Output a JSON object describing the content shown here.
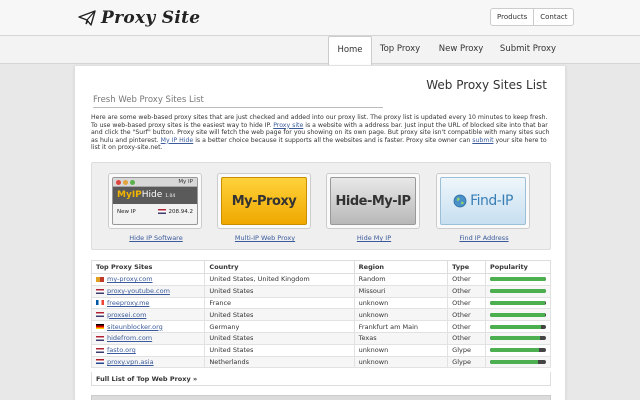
{
  "site": {
    "logo_text": "Proxy Site",
    "logo_icon": "paper-plane-icon"
  },
  "top_links": [
    "Products",
    "Contact"
  ],
  "nav": [
    "Home",
    "Top Proxy",
    "New Proxy",
    "Submit Proxy"
  ],
  "nav_active": "Home",
  "page_title": "Web Proxy Sites List",
  "section_title": "Fresh Web Proxy Sites List",
  "intro": {
    "p1": "Here are some web-based proxy sites that are just checked and added into our proxy list. The proxy list is updated every 10 minutes to keep fresh. To use web-based proxy sites is the easiest way to hide IP. ",
    "link1": "Proxy site",
    "p2": " is a website with a address bar. Just input the URL of blocked site into that bar and click the \"Surf\" button. Proxy site will fetch the web page for you showing on its own page. But proxy site isn't compatible with many sites such as hulu and pinterest. ",
    "link2": "My IP Hide",
    "p3": " is a better choice because it supports all the websites and is faster. Proxy site owner can ",
    "link3": "submit",
    "p4": " your site here to list it on proxy-site.net."
  },
  "featured": [
    {
      "label": "Hide IP Software",
      "image_type": "myip-window",
      "window_title": "My IP",
      "app_name_a": "MyIP",
      "app_name_b": "Hide",
      "version": "1.04",
      "status_label": "New IP",
      "ip_text": "208.94.2"
    },
    {
      "label": "Multi-IP Web Proxy",
      "image_type": "banner",
      "banner_text": "My-Proxy",
      "style": "yellow"
    },
    {
      "label": "Hide My IP",
      "image_type": "banner",
      "banner_text": "Hide-My-IP",
      "style": "gray"
    },
    {
      "label": "Find IP Address",
      "image_type": "banner",
      "banner_text": "Find-IP",
      "style": "blue",
      "icon": "globe-icon"
    }
  ],
  "table": {
    "headers": [
      "Top Proxy Sites",
      "Country",
      "Region",
      "Type",
      "Popularity"
    ],
    "rows": [
      {
        "site": "my-proxy.com",
        "flag": "multi",
        "country": "United States, United Kingdom",
        "region": "Random",
        "type": "Other",
        "popularity": 1.0
      },
      {
        "site": "proxy-youtube.com",
        "flag": "us",
        "country": "United States",
        "region": "Missouri",
        "type": "Other",
        "popularity": 1.0
      },
      {
        "site": "freeproxy.me",
        "flag": "fr",
        "country": "France",
        "region": "unknown",
        "type": "Other",
        "popularity": 0.98
      },
      {
        "site": "proxsei.com",
        "flag": "us",
        "country": "United States",
        "region": "unknown",
        "type": "Other",
        "popularity": 0.98
      },
      {
        "site": "siteunblocker.org",
        "flag": "de",
        "country": "Germany",
        "region": "Frankfurt am Main",
        "type": "Other",
        "popularity": 0.92
      },
      {
        "site": "hidefrom.com",
        "flag": "us",
        "country": "United States",
        "region": "Texas",
        "type": "Other",
        "popularity": 0.9
      },
      {
        "site": "fasto.org",
        "flag": "us",
        "country": "United States",
        "region": "unknown",
        "type": "Glype",
        "popularity": 0.88
      },
      {
        "site": "proxy.vpn.asia",
        "flag": "nl",
        "country": "Netherlands",
        "region": "unknown",
        "type": "Glype",
        "popularity": 0.86
      }
    ],
    "footer_link": "Full List of Top Web Proxy »"
  },
  "colors": {
    "link": "#3a5a9b",
    "popularity_fill": "#4caf50",
    "popularity_track": "#444444"
  }
}
